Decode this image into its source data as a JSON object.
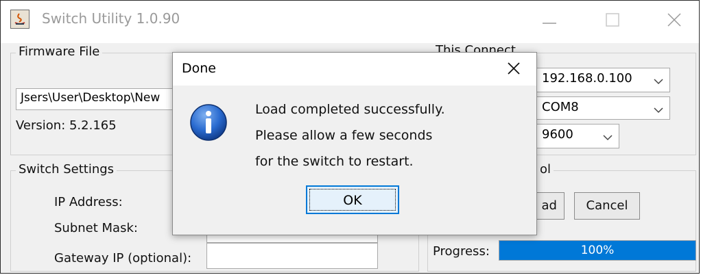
{
  "window": {
    "title": "Switch Utility 1.0.90"
  },
  "firmware": {
    "group_label": "Firmware File",
    "path_value": "Jsers\\User\\Desktop\\New",
    "version_label": "Version: 5.2.165"
  },
  "connect": {
    "group_label": "This Connect",
    "ip_value": "192.168.0.100",
    "port_value": "COM8",
    "baud_value": "9600"
  },
  "switch_settings": {
    "group_label": "Switch Settings",
    "ip_label": "IP Address:",
    "subnet_label": "Subnet Mask:",
    "gateway_label": "Gateway IP (optional):",
    "gateway_value": ""
  },
  "control": {
    "group_label": "ol",
    "load_label": "ad",
    "cancel_label": "Cancel",
    "progress_label": "Progress:",
    "progress_text": "100%",
    "progress_fraction": 1.0
  },
  "dialog": {
    "title": "Done",
    "message_lines": [
      "Load completed successfully.",
      "Please allow a few seconds",
      "for the switch to restart."
    ],
    "ok_label": "OK"
  },
  "colors": {
    "progress_fill": "#0078d7",
    "dialog_focus": "#0078d7",
    "info_icon": "#2a6bd0"
  }
}
